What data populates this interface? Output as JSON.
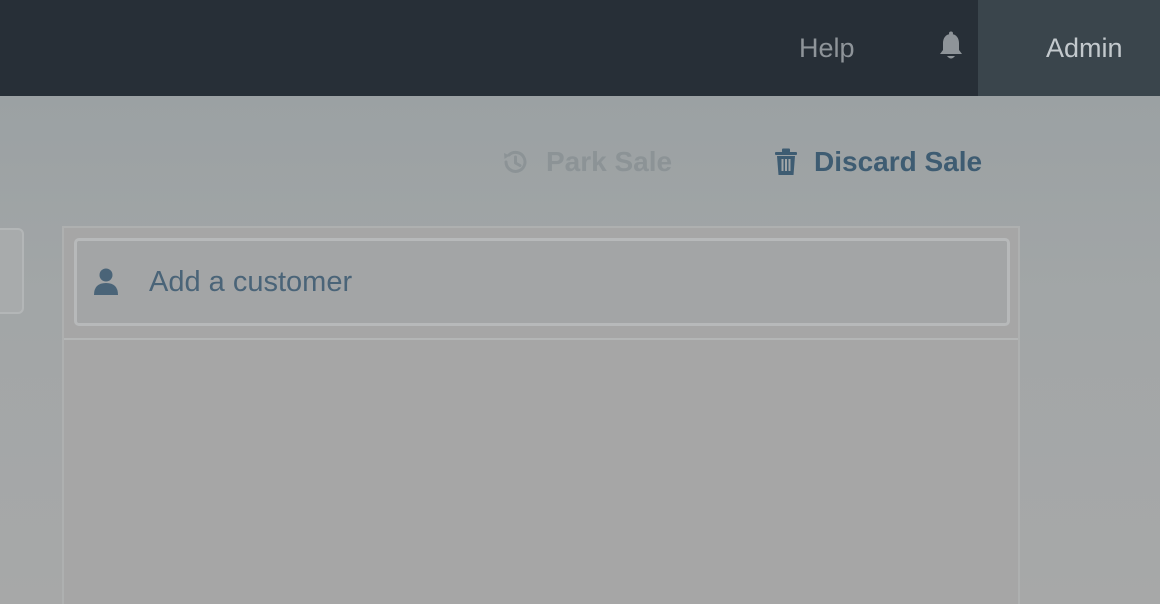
{
  "topbar": {
    "help_label": "Help",
    "notifications_icon": "bell-icon",
    "user_label": "Admin",
    "background_color": "#272f37",
    "active_tab_color": "#3a454c"
  },
  "sale_actions": {
    "park_sale_label": "Park Sale",
    "park_sale_icon": "history-icon",
    "discard_sale_label": "Discard Sale",
    "discard_sale_icon": "trash-icon",
    "discard_color": "#3e5c72"
  },
  "sale_panel": {
    "customer_placeholder": "Add a customer",
    "customer_icon": "user-icon"
  }
}
